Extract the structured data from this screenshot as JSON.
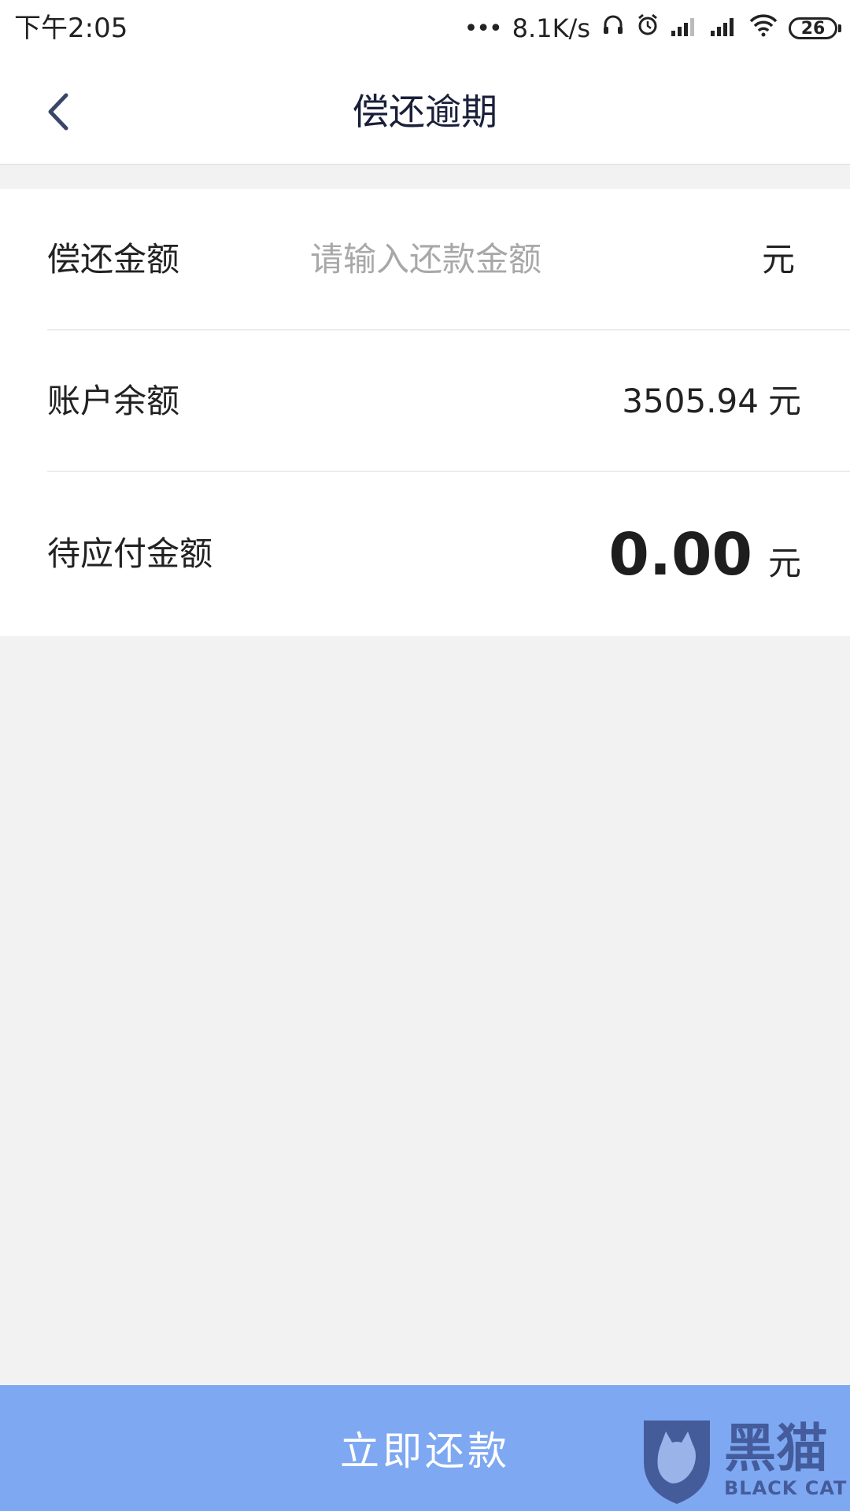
{
  "status_bar": {
    "time": "下午2:05",
    "network_speed": "8.1K/s",
    "battery_level": "26",
    "icons": [
      "dots-icon",
      "headset-icon",
      "alarm-icon",
      "signal-icon",
      "signal-icon",
      "wifi-icon",
      "battery-icon"
    ]
  },
  "nav": {
    "title": "偿还逾期",
    "back_icon": "chevron-left-icon"
  },
  "form": {
    "repay_amount": {
      "label": "偿还金额",
      "placeholder": "请输入还款金额",
      "value": "",
      "unit": "元"
    },
    "account_balance": {
      "label": "账户余额",
      "value": "3505.94",
      "unit": "元"
    },
    "payable": {
      "label": "待应付金额",
      "value": "0.00",
      "unit": "元"
    }
  },
  "action": {
    "pay_label": "立即还款"
  },
  "watermark": {
    "cn": "黑猫",
    "en": "BLACK CAT"
  },
  "colors": {
    "button": "#7ea8f2",
    "background": "#f2f2f2",
    "title": "#1a1f3a",
    "watermark": "#3b4f8c"
  }
}
